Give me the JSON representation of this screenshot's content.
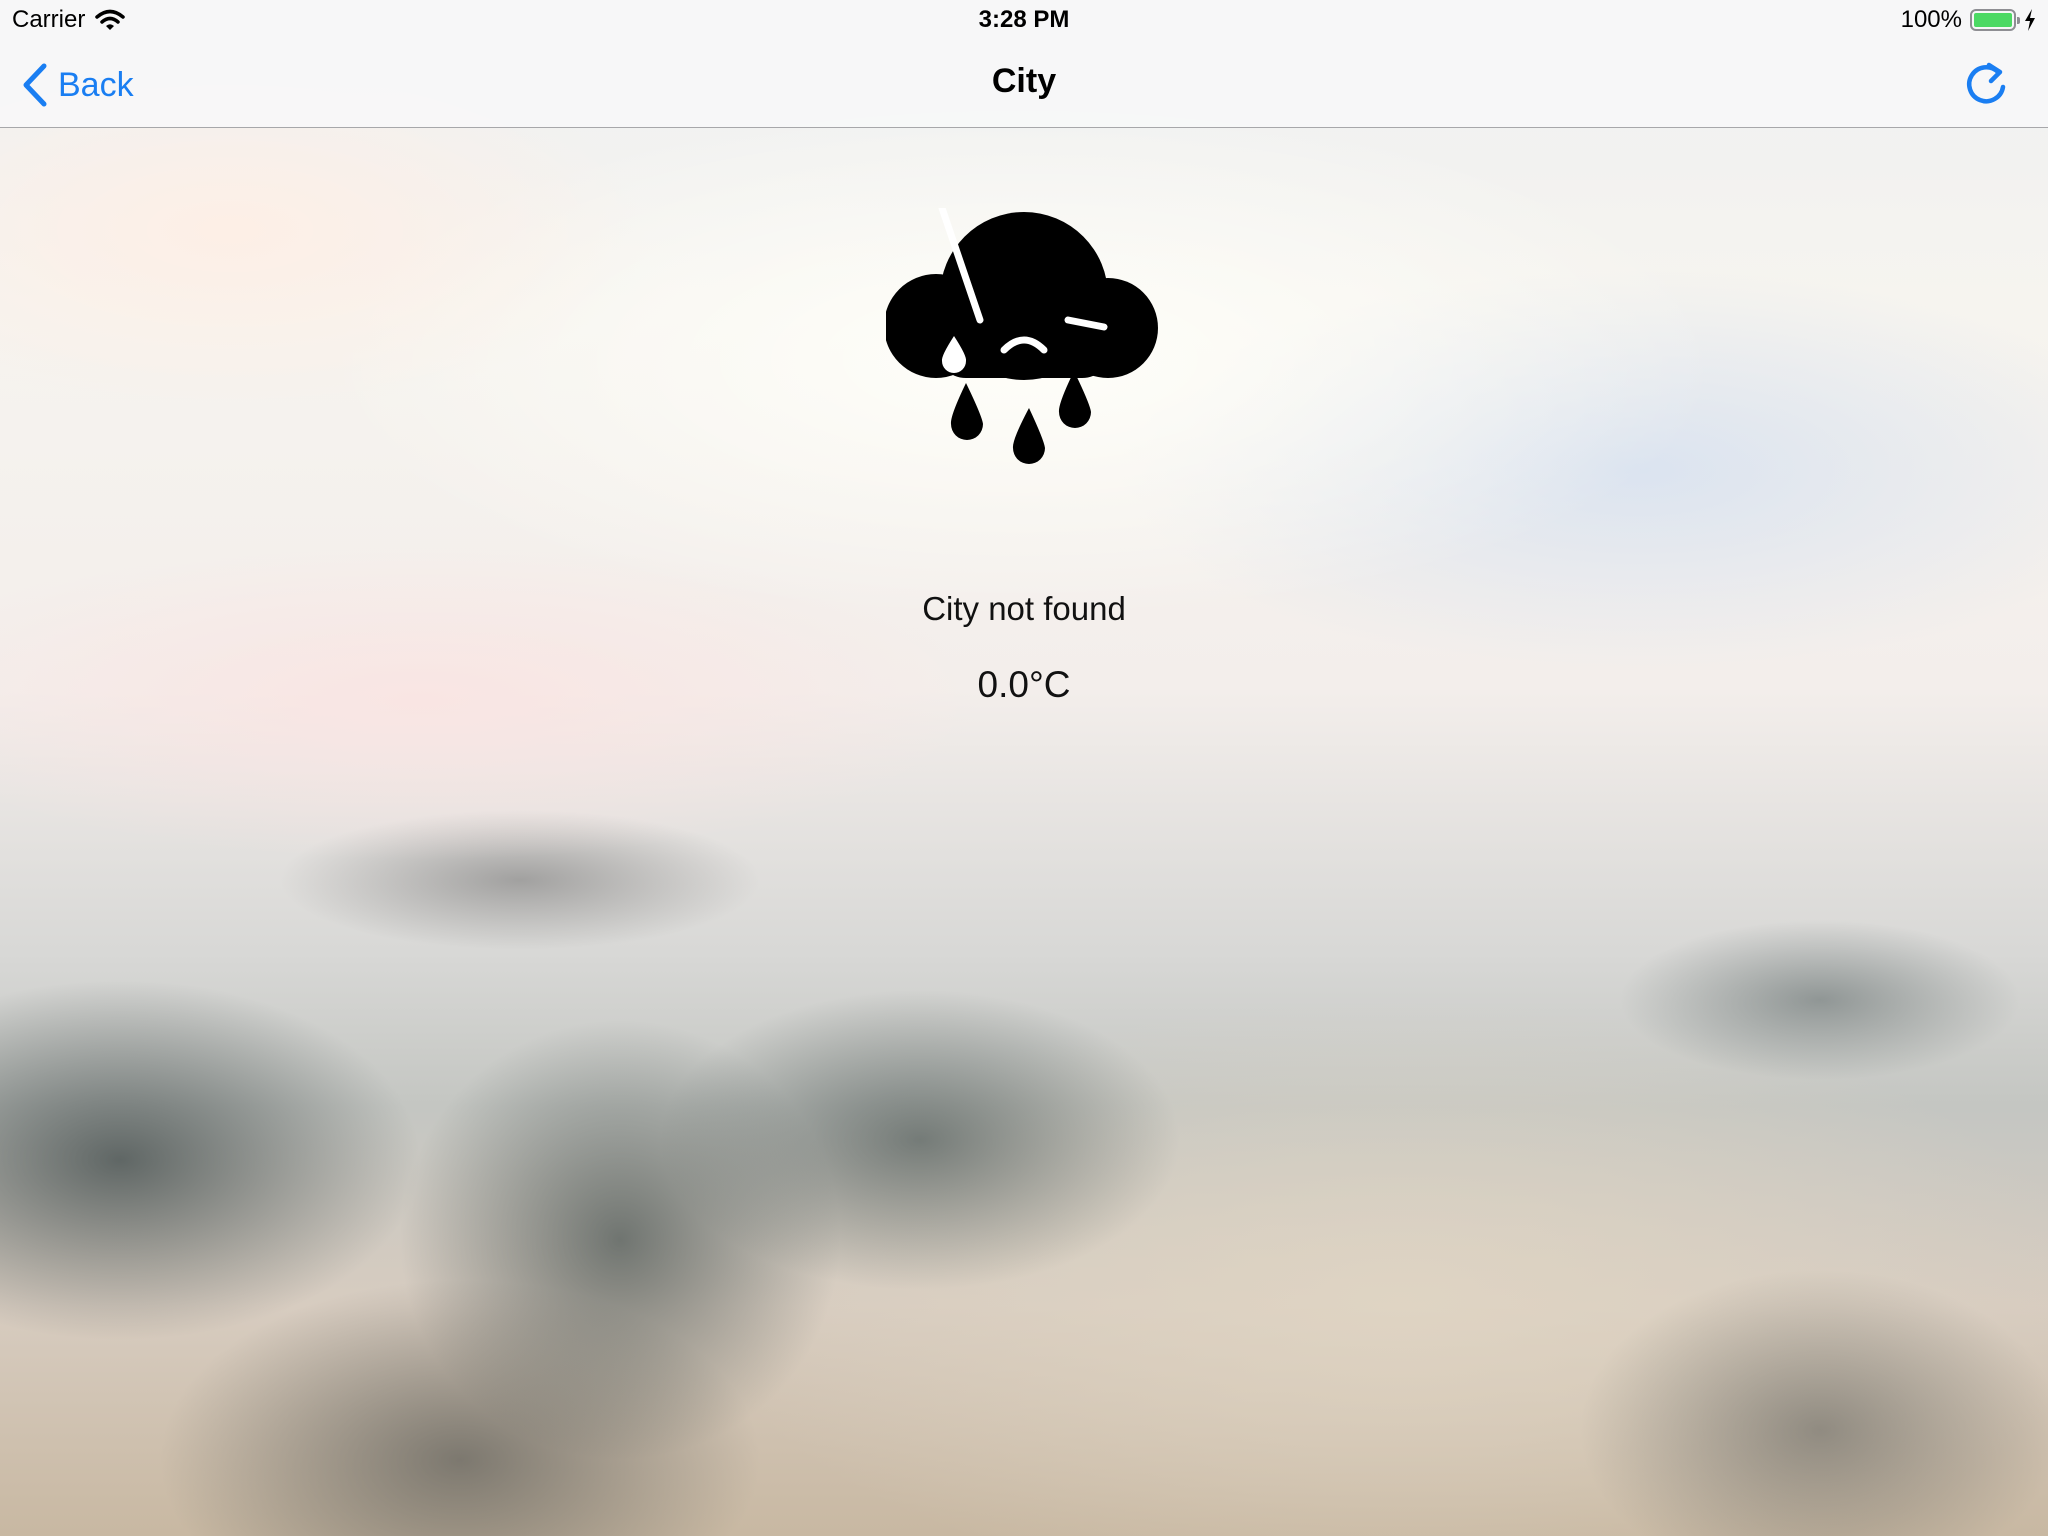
{
  "status_bar": {
    "carrier": "Carrier",
    "wifi_icon": "wifi-icon",
    "time": "3:28 PM",
    "battery_percent": "100%",
    "battery_level": 1.0,
    "battery_color": "#4cd964",
    "charging_icon": "bolt-icon"
  },
  "nav": {
    "back_label": "Back",
    "back_icon": "chevron-left-icon",
    "title": "City",
    "refresh_icon": "refresh-icon",
    "accent_color": "#1a7ef2"
  },
  "content": {
    "icon": "sad-rain-cloud-icon",
    "city_name": "City not found",
    "temperature": "0.0°C"
  }
}
